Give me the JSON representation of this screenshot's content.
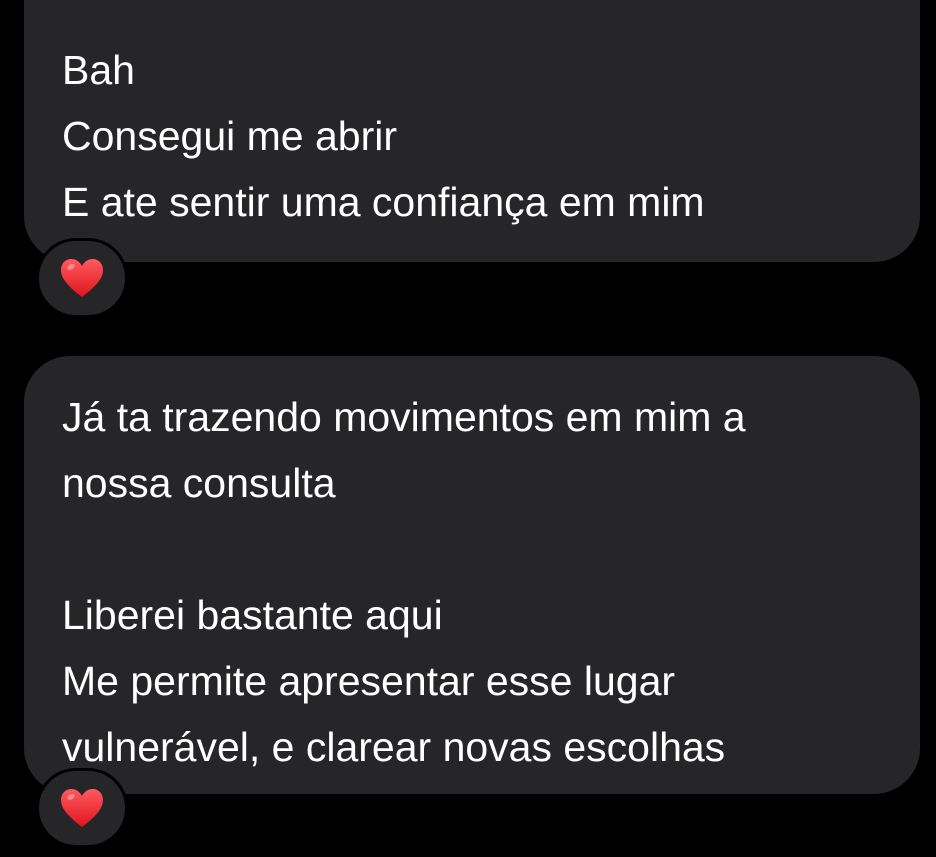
{
  "messages": [
    {
      "lines": [
        "Bah",
        "Consegui me abrir",
        "E ate sentir uma confiança em mim"
      ],
      "reaction": "heart-icon"
    },
    {
      "lines": [
        "Já ta trazendo movimentos em mim a",
        "nossa consulta",
        "",
        "Liberei bastante aqui",
        "Me permite apresentar esse lugar",
        "vulnerável, e clarear novas escolhas"
      ],
      "reaction": "heart-icon"
    }
  ],
  "colors": {
    "background": "#000000",
    "bubble": "#262628",
    "text": "#ffffff",
    "heart": "#ff1f2d"
  }
}
